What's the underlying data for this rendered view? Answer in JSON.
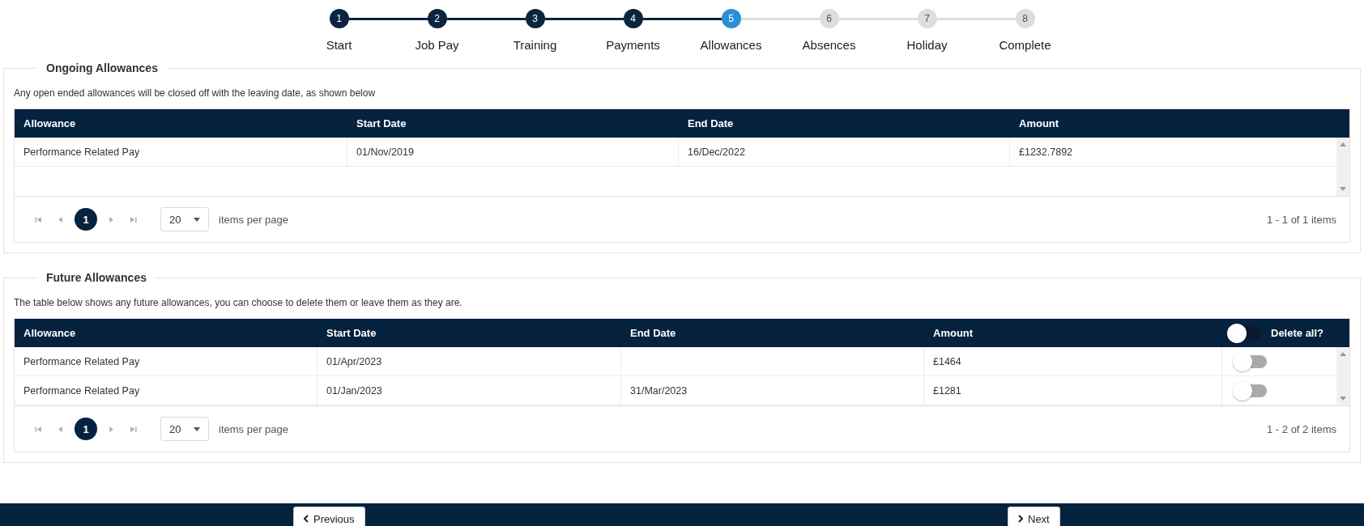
{
  "stepper": [
    {
      "number": "1",
      "label": "Start",
      "completed": true,
      "selected": false
    },
    {
      "number": "2",
      "label": "Job Pay",
      "completed": true,
      "selected": false
    },
    {
      "number": "3",
      "label": "Training",
      "completed": true,
      "selected": false
    },
    {
      "number": "4",
      "label": "Payments",
      "completed": true,
      "selected": false
    },
    {
      "number": "5",
      "label": "Allowances",
      "completed": false,
      "selected": true
    },
    {
      "number": "6",
      "label": "Absences",
      "completed": false,
      "selected": false
    },
    {
      "number": "7",
      "label": "Holiday",
      "completed": false,
      "selected": false
    },
    {
      "number": "8",
      "label": "Complete",
      "completed": false,
      "selected": false
    }
  ],
  "ongoing": {
    "title": "Ongoing Allowances",
    "description": "Any open ended allowances will be closed off with the leaving date, as shown below",
    "columns": [
      "Allowance",
      "Start Date",
      "End Date",
      "Amount"
    ],
    "rows": [
      {
        "allowance": "Performance Related Pay",
        "start_date": "01/Nov/2019",
        "end_date": "16/Dec/2022",
        "amount": "£1232.7892"
      }
    ],
    "pager": {
      "pages": [
        {
          "label": "1",
          "selected": true
        }
      ],
      "page_size": "20",
      "page_size_label": "items per page",
      "info": "1 - 1 of 1 items"
    }
  },
  "future": {
    "title": "Future Allowances",
    "description": "The table below shows any future allowances, you can choose to delete them or leave them as they are.",
    "columns": [
      "Allowance",
      "Start Date",
      "End Date",
      "Amount"
    ],
    "delete_all": {
      "label": "Delete all?",
      "on": false
    },
    "rows": [
      {
        "allowance": "Performance Related Pay",
        "start_date": "01/Apr/2023",
        "amount": "£1464",
        "delete": false
      },
      {
        "allowance": "Performance Related Pay",
        "start_date": "01/Jan/2023",
        "end_date": "31/Mar/2023",
        "amount": "£1281",
        "delete": false
      }
    ],
    "pager": {
      "pages": [
        {
          "label": "1",
          "selected": true
        }
      ],
      "page_size": "20",
      "page_size_label": "items per page",
      "info": "1 - 2 of 2 items"
    }
  },
  "footer": {
    "previous": "Previous",
    "next": "Next"
  }
}
